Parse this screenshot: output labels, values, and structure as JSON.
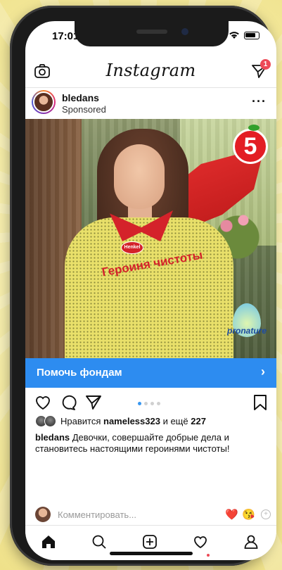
{
  "status_bar": {
    "time": "17:01"
  },
  "header": {
    "app_title": "Instagram",
    "dm_badge": "1"
  },
  "post": {
    "username": "bledans",
    "subtitle": "Sponsored",
    "ad_text": "Героиня чистоты",
    "brand_henkel": "Henkel",
    "brand_pyaterochka": "5",
    "brand_pronature": "pronature",
    "cta_label": "Помочь фондам",
    "carousel": {
      "count": 4,
      "active_index": 0
    },
    "likes": {
      "prefix": "Нравится",
      "user": "nameless323",
      "middle": "и ещё",
      "count": "227"
    },
    "caption": {
      "author": "bledans",
      "text": "Девочки, совершайте добрые дела и становитесь настоящими героинями чистоты!"
    },
    "comment_placeholder": "Комментировать...",
    "quick_reactions": [
      "❤️",
      "😘"
    ]
  },
  "icons": {
    "top_left": "camera-icon",
    "top_right": "direct-message-icon",
    "actions": [
      "heart-icon",
      "comment-icon",
      "share-icon",
      "bookmark-icon"
    ],
    "tabs": [
      "home-icon",
      "search-icon",
      "add-post-icon",
      "activity-icon",
      "profile-icon"
    ]
  },
  "colors": {
    "cta": "#2d8cf0",
    "badge": "#ed4956",
    "brand_red": "#e31e24"
  }
}
